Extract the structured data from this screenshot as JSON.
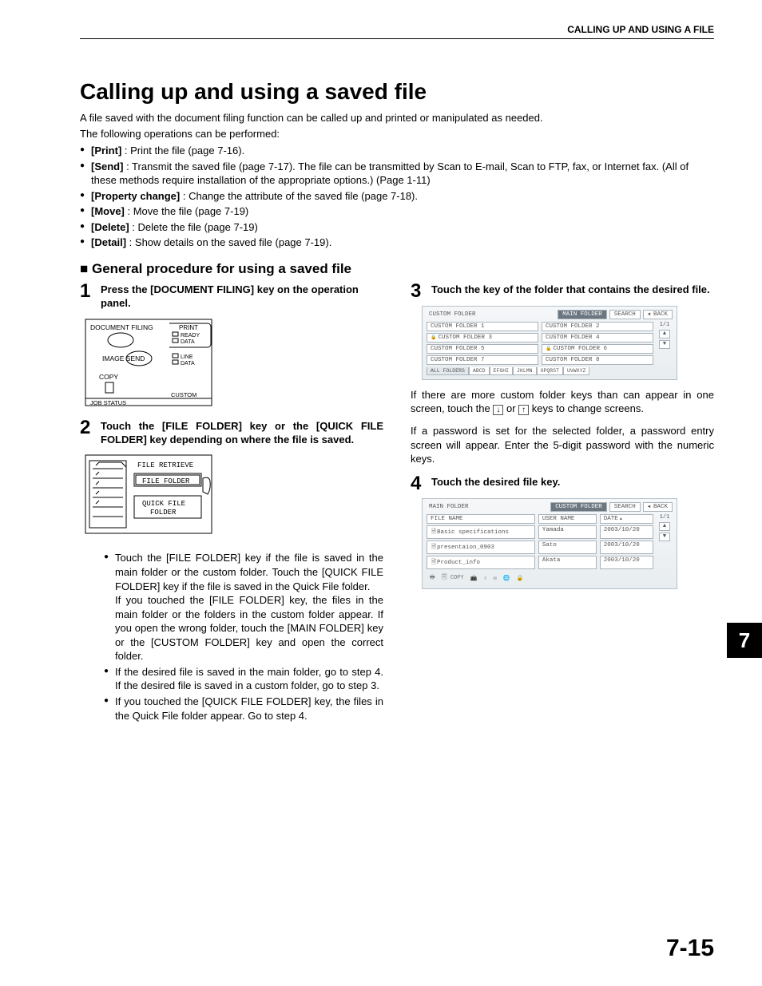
{
  "header": "CALLING UP AND USING A FILE",
  "title": "Calling up and using a saved file",
  "intro1": "A file saved with the document filing function can be called up and printed or manipulated as needed.",
  "intro2": "The following operations can be performed:",
  "ops": [
    {
      "b": "[Print]",
      "t": " : Print the file (page 7-16)."
    },
    {
      "b": "[Send]",
      "t": " : Transmit the saved file (page 7-17). The file can be transmitted by Scan to E-mail, Scan to FTP, fax, or Internet fax. (All of these methods require installation of the appropriate options.) (Page 1-11)"
    },
    {
      "b": "[Property change]",
      "t": " : Change the attribute of the saved file (page 7-18)."
    },
    {
      "b": "[Move]",
      "t": " : Move the file (page 7-19)"
    },
    {
      "b": "[Delete]",
      "t": " : Delete the file (page 7-19)"
    },
    {
      "b": "[Detail]",
      "t": " : Show details on the saved file (page 7-19)."
    }
  ],
  "subhead": "General procedure for using a saved file",
  "steps": {
    "s1": "Press the [DOCUMENT FILING] key on the operation panel.",
    "s2": "Touch the [FILE FOLDER] key or the [QUICK FILE FOLDER] key depending on where the file is saved.",
    "s2notes": [
      "Touch the [FILE FOLDER] key if the file is saved in the main folder or the custom folder. Touch the [QUICK FILE FOLDER] key if the file is saved in the Quick File folder.\nIf you touched the [FILE FOLDER] key, the files in the main folder or the folders in the custom folder appear. If you open the wrong folder, touch the [MAIN FOLDER] key or the [CUSTOM FOLDER] key and open the correct folder.",
      "If the desired file is saved in the main folder, go to step 4. If the desired file is saved in a custom folder, go to step 3.",
      "If you touched the [QUICK FILE FOLDER] key, the files in the Quick File folder appear. Go to step 4."
    ],
    "s3": "Touch the key of the folder that contains the desired file.",
    "s3p1a": "If there are more custom folder keys than can appear in one screen, touch the ",
    "s3p1b": " or ",
    "s3p1c": " keys to change screens.",
    "s3p2": "If a password is set for the selected folder, a password entry screen will appear. Enter the 5-digit password with the numeric keys.",
    "s4": "Touch the desired file key."
  },
  "panel": {
    "docfiling": "DOCUMENT FILING",
    "print": "PRINT",
    "ready": "READY",
    "data1": "DATA",
    "imagesend": "IMAGE SEND",
    "line": "LINE",
    "data2": "DATA",
    "copy": "COPY",
    "custom": "CUSTOM",
    "job": "JOB STATUS"
  },
  "retrieve": {
    "title": "FILE RETRIEVE",
    "ff": "FILE FOLDER",
    "qff1": "QUICK FILE",
    "qff2": "FOLDER"
  },
  "screen3": {
    "title": "CUSTOM FOLDER",
    "mainfolder": "MAIN FOLDER",
    "search": "SEARCH",
    "back": "BACK",
    "page": "1/1",
    "folders": [
      "CUSTOM FOLDER 1",
      "CUSTOM FOLDER 2",
      "CUSTOM FOLDER 3",
      "CUSTOM FOLDER 4",
      "CUSTOM FOLDER 5",
      "CUSTOM FOLDER 6",
      "CUSTOM FOLDER 7",
      "CUSTOM FOLDER 8"
    ],
    "tabs": [
      "ALL FOLDERS",
      "ABCD",
      "EFGHI",
      "JKLMN",
      "OPQRST",
      "UVWXYZ"
    ]
  },
  "screen4": {
    "title": "MAIN FOLDER",
    "custom": "CUSTOM FOLDER",
    "search": "SEARCH",
    "back": "BACK",
    "hfile": "FILE NAME",
    "huser": "USER NAME",
    "hdate": "DATE",
    "page": "1/1",
    "rows": [
      {
        "f": "Basic specifications",
        "u": "Yamada",
        "d": "2003/10/20"
      },
      {
        "f": "presentaion_0903",
        "u": "Sato",
        "d": "2003/10/20"
      },
      {
        "f": "Product_info",
        "u": "Akata",
        "d": "2003/10/20"
      }
    ],
    "copy": "COPY"
  },
  "chapter": "7",
  "pagenum": "7-15"
}
